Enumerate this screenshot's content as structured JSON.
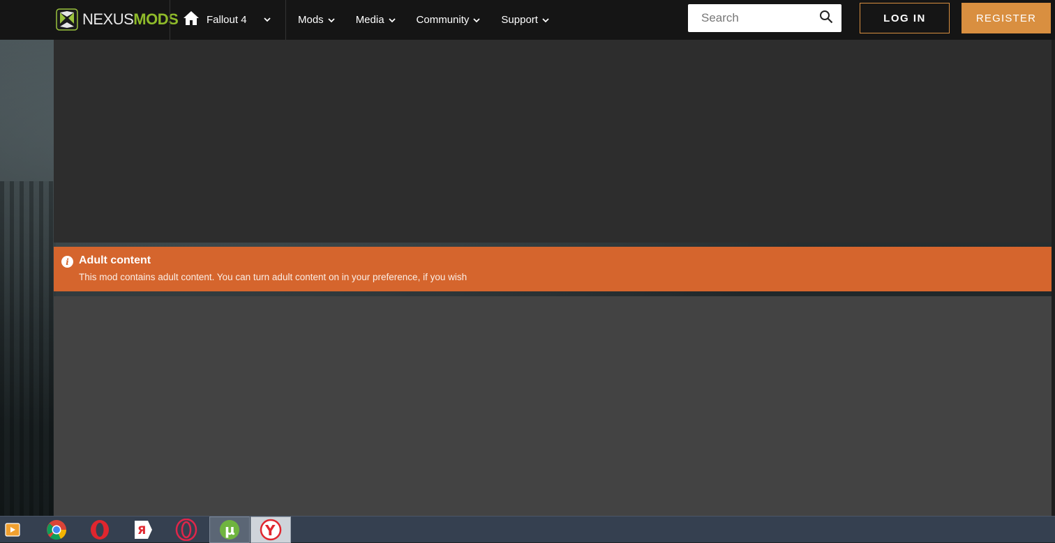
{
  "header": {
    "logo": {
      "text_nexus": "NEXUS",
      "text_mods": "MODS",
      "icon": "nexus-logo-icon"
    },
    "game": {
      "label": "Fallout 4",
      "icon": "home-icon"
    },
    "nav": [
      {
        "label": "Mods"
      },
      {
        "label": "Media"
      },
      {
        "label": "Community"
      },
      {
        "label": "Support"
      }
    ],
    "search": {
      "placeholder": "Search",
      "value": ""
    },
    "login_label": "LOG IN",
    "register_label": "REGISTER"
  },
  "alert": {
    "icon": "info-icon",
    "title": "Adult content",
    "message": "This mod contains adult content. You can turn adult content on in your preference, if you wish"
  },
  "taskbar": {
    "apps": [
      {
        "name": "media-player-icon"
      },
      {
        "name": "chrome-icon"
      },
      {
        "name": "opera-icon"
      },
      {
        "name": "yandex-icon",
        "glyph": "Я"
      },
      {
        "name": "opera-gx-icon"
      },
      {
        "name": "utorrent-icon",
        "glyph": "µ"
      },
      {
        "name": "yandex-browser-icon",
        "glyph": "Y"
      }
    ]
  },
  "colors": {
    "accent": "#d98f40",
    "alert": "#d5652d",
    "brand_green": "#8fbb2a"
  }
}
